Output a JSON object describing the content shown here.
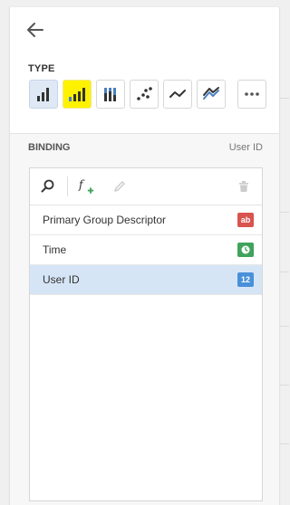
{
  "colors": {
    "accent": "#4a7fc1",
    "selected_bg": "#d6e5f6",
    "highlight": "#fff200",
    "badge_text": "#d9534f",
    "badge_time": "#3fa35b",
    "badge_number": "#4a90d9"
  },
  "header": {
    "back_icon": "arrow-left-icon"
  },
  "type_section": {
    "label": "TYPE",
    "buttons": [
      {
        "icon": "bar-chart-icon",
        "selected": true
      },
      {
        "icon": "bar-chart-highlighted-icon",
        "highlighted": true
      },
      {
        "icon": "stacked-bar-chart-icon"
      },
      {
        "icon": "scatter-chart-icon"
      },
      {
        "icon": "line-chart-icon"
      },
      {
        "icon": "area-chart-icon"
      },
      {
        "icon": "more-icon"
      }
    ]
  },
  "binding": {
    "label": "BINDING",
    "value": "User ID",
    "toolbar": [
      "search-icon",
      "add-formula-icon",
      "edit-icon",
      "trash-icon"
    ],
    "items": [
      {
        "label": "Primary Group Descriptor",
        "type_badge": "ab",
        "type_icon": "text-type-icon"
      },
      {
        "label": "Time",
        "type_badge": "",
        "type_icon": "time-type-icon"
      },
      {
        "label": "User ID",
        "type_badge": "12",
        "type_icon": "number-type-icon",
        "selected": true
      }
    ]
  }
}
